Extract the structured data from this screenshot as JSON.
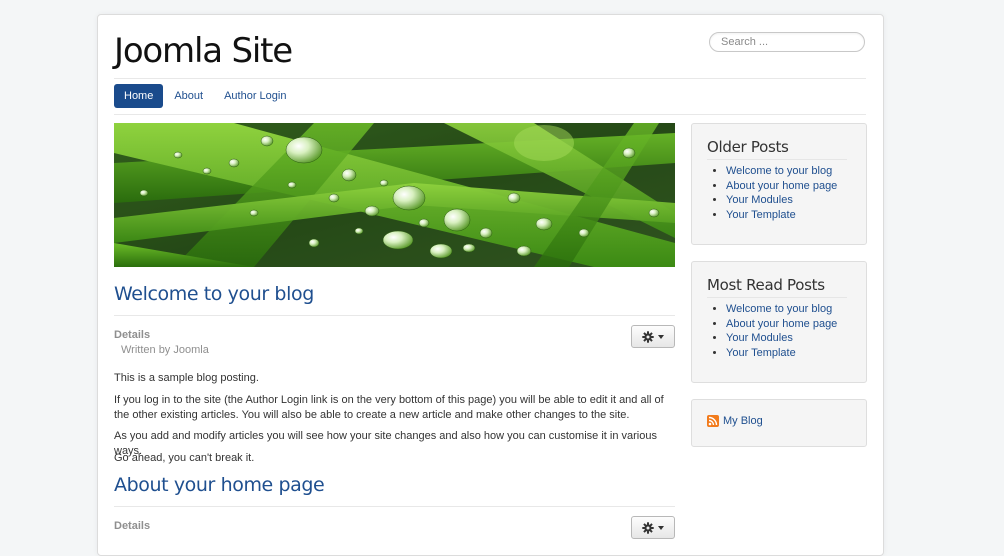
{
  "header": {
    "site_title": "Joomla Site",
    "search_placeholder": "Search ..."
  },
  "nav": {
    "items": [
      {
        "label": "Home",
        "active": true
      },
      {
        "label": "About",
        "active": false
      },
      {
        "label": "Author Login",
        "active": false
      }
    ]
  },
  "articles": [
    {
      "title": "Welcome to your blog",
      "details_label": "Details",
      "written_by": "Written by Joomla",
      "paragraphs": [
        "This is a sample blog posting.",
        "If you log in to the site (the Author Login link is on the very bottom of this page) you will be able to edit it and all of the other existing articles. You will also be able to create a new article and make other changes to the site.",
        "As you add and modify articles you will see how your site changes and also how you can customise it in various ways.",
        "Go ahead, you can't break it."
      ]
    },
    {
      "title": "About your home page",
      "details_label": "Details"
    }
  ],
  "sidebar": {
    "older_posts": {
      "title": "Older Posts",
      "items": [
        "Welcome to your blog",
        "About your home page",
        "Your Modules",
        "Your Template"
      ]
    },
    "most_read": {
      "title": "Most Read Posts",
      "items": [
        "Welcome to your blog",
        "About your home page",
        "Your Modules",
        "Your Template"
      ]
    },
    "feed": {
      "label": "My Blog",
      "icon": "rss-feed-icon"
    }
  },
  "colors": {
    "accent": "#1a4b8c",
    "link": "#1f4f8f"
  }
}
